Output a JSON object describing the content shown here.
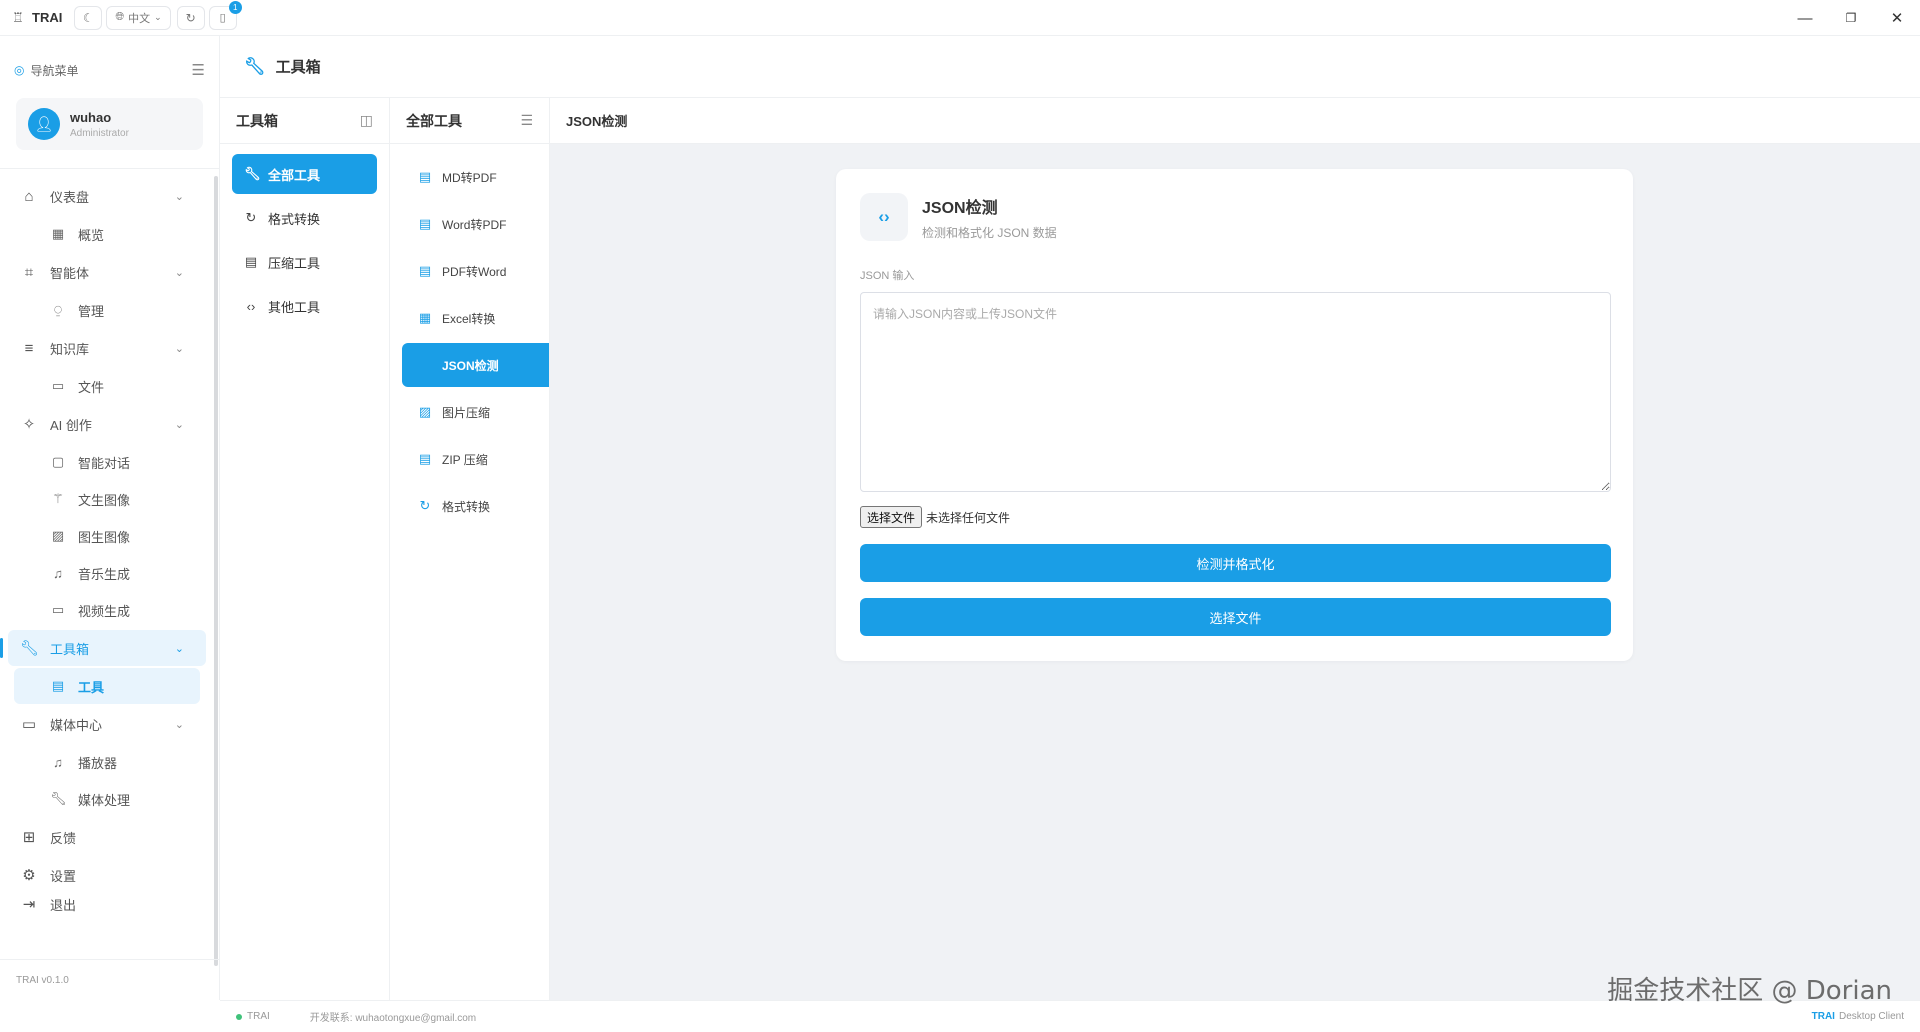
{
  "titlebar": {
    "app_name": "TRAI",
    "lang": "中文",
    "notification_count": "1"
  },
  "sidebar": {
    "nav_title": "导航菜单",
    "user": {
      "name": "wuhao",
      "role": "Administrator"
    },
    "version": "TRAI v0.1.0",
    "groups": {
      "dashboard": "仪表盘",
      "overview": "概览",
      "agent": "智能体",
      "manage": "管理",
      "kb": "知识库",
      "files": "文件",
      "ai_create": "AI 创作",
      "chat": "智能对话",
      "text2img": "文生图像",
      "img2img": "图生图像",
      "music": "音乐生成",
      "video": "视频生成",
      "toolbox": "工具箱",
      "tools": "工具",
      "media": "媒体中心",
      "player": "播放器",
      "media_proc": "媒体处理",
      "feedback": "反馈",
      "settings": "设置",
      "logout": "退出"
    }
  },
  "header": {
    "title": "工具箱"
  },
  "categories": {
    "title": "工具箱",
    "items": [
      "全部工具",
      "格式转换",
      "压缩工具",
      "其他工具"
    ]
  },
  "tools": {
    "title": "全部工具",
    "items": [
      "MD转PDF",
      "Word转PDF",
      "PDF转Word",
      "Excel转换",
      "JSON检测",
      "图片压缩",
      "ZIP 压缩",
      "格式转换"
    ]
  },
  "content": {
    "breadcrumb": "JSON检测",
    "card_title": "JSON检测",
    "card_subtitle": "检测和格式化 JSON 数据",
    "input_label": "JSON 输入",
    "input_placeholder": "请输入JSON内容或上传JSON文件",
    "file_button": "选择文件",
    "file_status": "未选择任何文件",
    "check_button": "检测并格式化",
    "select_button": "选择文件"
  },
  "statusbar": {
    "app": "TRAI",
    "contact": "开发联系: wuhaotongxue@gmail.com",
    "brand": "TRAI",
    "client": "Desktop Client"
  },
  "watermark": "掘金技术社区 @ Dorian",
  "colors": {
    "accent": "#1a9ee6",
    "status_ok": "#3fc27a"
  }
}
